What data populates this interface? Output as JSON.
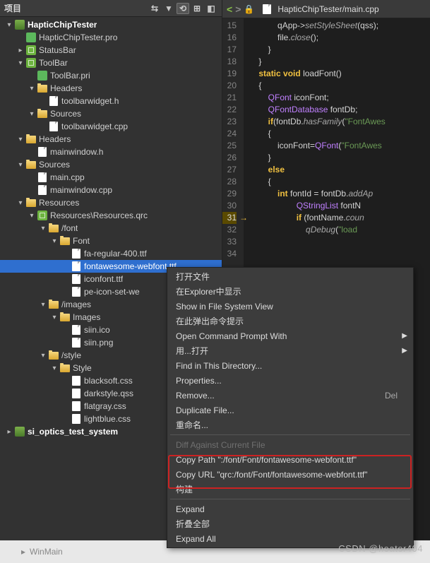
{
  "sidebar": {
    "title": "项目"
  },
  "tree": [
    {
      "indent": 0,
      "exp": "▾",
      "icon": "prj",
      "text": "HapticChipTester",
      "bold": true
    },
    {
      "indent": 1,
      "exp": "",
      "icon": "pro",
      "text": "HapticChipTester.pro"
    },
    {
      "indent": 1,
      "exp": "▸",
      "icon": "qrc",
      "text": "StatusBar"
    },
    {
      "indent": 1,
      "exp": "▾",
      "icon": "qrc",
      "text": "ToolBar"
    },
    {
      "indent": 2,
      "exp": "",
      "icon": "pro",
      "text": "ToolBar.pri"
    },
    {
      "indent": 2,
      "exp": "▾",
      "icon": "folder",
      "text": "Headers"
    },
    {
      "indent": 3,
      "exp": "",
      "icon": "cpp",
      "text": "toolbarwidget.h"
    },
    {
      "indent": 2,
      "exp": "▾",
      "icon": "folder",
      "text": "Sources"
    },
    {
      "indent": 3,
      "exp": "",
      "icon": "cpp",
      "text": "toolbarwidget.cpp"
    },
    {
      "indent": 1,
      "exp": "▾",
      "icon": "folder",
      "text": "Headers"
    },
    {
      "indent": 2,
      "exp": "",
      "icon": "cpp",
      "text": "mainwindow.h"
    },
    {
      "indent": 1,
      "exp": "▾",
      "icon": "folder",
      "text": "Sources"
    },
    {
      "indent": 2,
      "exp": "",
      "icon": "cpp",
      "text": "main.cpp"
    },
    {
      "indent": 2,
      "exp": "",
      "icon": "cpp",
      "text": "mainwindow.cpp"
    },
    {
      "indent": 1,
      "exp": "▾",
      "icon": "folder",
      "text": "Resources"
    },
    {
      "indent": 2,
      "exp": "▾",
      "icon": "qrc",
      "text": "Resources\\Resources.qrc"
    },
    {
      "indent": 3,
      "exp": "▾",
      "icon": "folder",
      "text": "/font"
    },
    {
      "indent": 4,
      "exp": "▾",
      "icon": "folder",
      "text": "Font"
    },
    {
      "indent": 5,
      "exp": "",
      "icon": "cpp",
      "text": "fa-regular-400.ttf"
    },
    {
      "indent": 5,
      "exp": "",
      "icon": "cpp",
      "text": "fontawesome-webfont.ttf",
      "sel": true
    },
    {
      "indent": 5,
      "exp": "",
      "icon": "cpp",
      "text": "iconfont.ttf"
    },
    {
      "indent": 5,
      "exp": "",
      "icon": "cpp",
      "text": "pe-icon-set-we"
    },
    {
      "indent": 3,
      "exp": "▾",
      "icon": "folder",
      "text": "/images"
    },
    {
      "indent": 4,
      "exp": "▾",
      "icon": "folder",
      "text": "Images"
    },
    {
      "indent": 5,
      "exp": "",
      "icon": "cpp",
      "text": "siin.ico"
    },
    {
      "indent": 5,
      "exp": "",
      "icon": "cpp",
      "text": "siin.png"
    },
    {
      "indent": 3,
      "exp": "▾",
      "icon": "folder",
      "text": "/style"
    },
    {
      "indent": 4,
      "exp": "▾",
      "icon": "folder",
      "text": "Style"
    },
    {
      "indent": 5,
      "exp": "",
      "icon": "css",
      "text": "blacksoft.css"
    },
    {
      "indent": 5,
      "exp": "",
      "icon": "css",
      "text": "darkstyle.qss"
    },
    {
      "indent": 5,
      "exp": "",
      "icon": "css",
      "text": "flatgray.css"
    },
    {
      "indent": 5,
      "exp": "",
      "icon": "css",
      "text": "lightblue.css"
    },
    {
      "indent": 0,
      "exp": "▸",
      "icon": "prj",
      "text": "si_optics_test_system",
      "bold": true
    }
  ],
  "editor": {
    "tab": "HapticChipTester/main.cpp",
    "lines": [
      15,
      16,
      17,
      18,
      19,
      20,
      21,
      22,
      23,
      24,
      25,
      26,
      27,
      28,
      29,
      30,
      31,
      32,
      33,
      34
    ],
    "markLine": 31
  },
  "code": [
    {
      "segs": [
        [
          "",
          "            "
        ],
        [
          "id",
          "qApp"
        ],
        [
          "",
          "->"
        ],
        [
          "fn",
          "setStyleSheet"
        ],
        [
          "",
          "(qss);"
        ]
      ]
    },
    {
      "segs": [
        [
          "",
          "            file."
        ],
        [
          "fn",
          "close"
        ],
        [
          "",
          "();"
        ]
      ]
    },
    {
      "segs": [
        [
          "",
          "        }"
        ]
      ]
    },
    {
      "segs": [
        [
          "",
          "    }"
        ]
      ]
    },
    {
      "segs": [
        [
          "",
          ""
        ]
      ]
    },
    {
      "segs": [
        [
          "",
          "    "
        ],
        [
          "kw",
          "static"
        ],
        [
          "",
          " "
        ],
        [
          "kw",
          "void"
        ],
        [
          "",
          " "
        ],
        [
          "id",
          "loadFont"
        ],
        [
          "",
          "()"
        ]
      ]
    },
    {
      "segs": [
        [
          "",
          "    {"
        ]
      ]
    },
    {
      "segs": [
        [
          "",
          "        "
        ],
        [
          "type",
          "QFont"
        ],
        [
          "",
          " iconFont;"
        ]
      ]
    },
    {
      "segs": [
        [
          "",
          "        "
        ],
        [
          "type",
          "QFontDatabase"
        ],
        [
          "",
          " fontDb;"
        ]
      ]
    },
    {
      "segs": [
        [
          "",
          "        "
        ],
        [
          "kw",
          "if"
        ],
        [
          "",
          "(fontDb."
        ],
        [
          "fn",
          "hasFamily"
        ],
        [
          "",
          "("
        ],
        [
          "str",
          "\"FontAwes"
        ]
      ]
    },
    {
      "segs": [
        [
          "",
          "        {"
        ]
      ]
    },
    {
      "segs": [
        [
          "",
          "            iconFont="
        ],
        [
          "type",
          "QFont"
        ],
        [
          "",
          "("
        ],
        [
          "str",
          "\"FontAwes"
        ]
      ]
    },
    {
      "segs": [
        [
          "",
          "        }"
        ]
      ]
    },
    {
      "segs": [
        [
          "",
          "        "
        ],
        [
          "kw",
          "else"
        ]
      ]
    },
    {
      "segs": [
        [
          "",
          "        {"
        ]
      ]
    },
    {
      "segs": [
        [
          "",
          "            "
        ],
        [
          "kw",
          "int"
        ],
        [
          "",
          " "
        ],
        [
          "id",
          "fontId"
        ],
        [
          "",
          " = fontDb."
        ],
        [
          "fn",
          "addAp"
        ]
      ]
    },
    {
      "segs": [
        [
          "",
          "                    "
        ],
        [
          "type",
          "QStringList"
        ],
        [
          "",
          " fontN"
        ]
      ]
    },
    {
      "segs": [
        [
          "",
          "                    "
        ],
        [
          "kw",
          "if"
        ],
        [
          "",
          " (fontName."
        ],
        [
          "fn",
          "coun"
        ]
      ]
    },
    {
      "segs": [
        [
          "",
          "                        "
        ],
        [
          "fn",
          "qDebug"
        ],
        [
          "",
          "("
        ],
        [
          "str",
          "\"load "
        ]
      ]
    },
    {
      "segs": [
        [
          "",
          ""
        ]
      ]
    }
  ],
  "menu": [
    {
      "t": "打开文件"
    },
    {
      "t": "在Explorer中显示"
    },
    {
      "t": "Show in File System View"
    },
    {
      "t": "在此弹出命令提示"
    },
    {
      "t": "Open Command Prompt With",
      "sub": true
    },
    {
      "t": "用...打开",
      "sub": true
    },
    {
      "t": "Find in This Directory..."
    },
    {
      "t": "Properties..."
    },
    {
      "t": "Remove...",
      "right": "Del"
    },
    {
      "t": "Duplicate File..."
    },
    {
      "t": "重命名..."
    },
    {
      "sep": true
    },
    {
      "t": "Diff Against Current File",
      "dis": true
    },
    {
      "t": "Copy Path \":/font/Font/fontawesome-webfont.ttf\""
    },
    {
      "t": "Copy URL \"qrc:/font/Font/fontawesome-webfont.ttf\""
    },
    {
      "t": "构建"
    },
    {
      "sep": true
    },
    {
      "t": "Expand"
    },
    {
      "t": "折叠全部"
    },
    {
      "t": "Expand All"
    }
  ],
  "watermark": "CSDN @heater404",
  "footer": "WinMain"
}
